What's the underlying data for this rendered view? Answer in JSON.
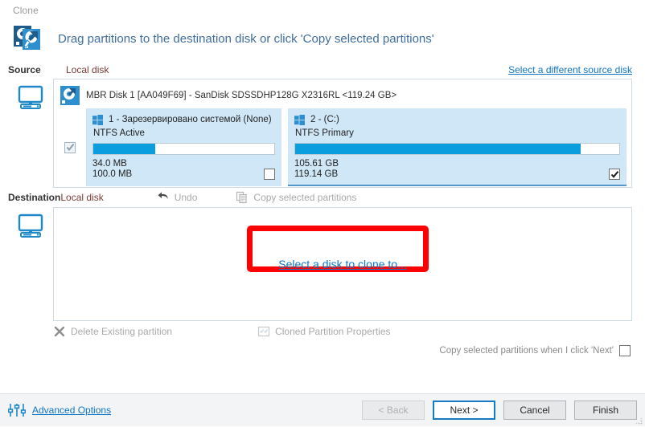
{
  "window": {
    "title": "Clone"
  },
  "header": {
    "title": "Drag partitions to the destination disk or click 'Copy selected partitions'",
    "icon": "clone-disks-icon"
  },
  "source": {
    "label": "Source",
    "disk_type": "Local disk",
    "change_link": "Select a different source disk",
    "monitor_icon": "computer-icon",
    "disk": {
      "icon": "hard-disk-icon",
      "title": "MBR Disk 1 [AA049F69] - SanDisk SDSSDHP128G X2316RL  <119.24 GB>",
      "selected": true,
      "partitions": [
        {
          "index": "1",
          "name": "1 - Зарезервировано системой (None)",
          "filesystem": "NTFS Active",
          "used": "34.0 MB",
          "total": "100.0 MB",
          "used_percent": 34,
          "checked": false,
          "os_icon": "windows-logo-icon"
        },
        {
          "index": "2",
          "name": "2 -  (C:)",
          "filesystem": "NTFS Primary",
          "used": "105.61 GB",
          "total": "119.14 GB",
          "used_percent": 88,
          "checked": true,
          "os_icon": "windows-logo-icon"
        }
      ]
    }
  },
  "destination": {
    "label": "Destination",
    "disk_type": "Local disk",
    "monitor_icon": "computer-icon",
    "toolbar": {
      "undo": "Undo",
      "undo_icon": "undo-arrow-icon",
      "copy_selected": "Copy selected partitions",
      "copy_icon": "copy-pages-icon"
    },
    "empty_link": "Select a disk to clone to...",
    "annotation": "red-highlight-box"
  },
  "bottom_tools": {
    "delete_partition": "Delete Existing partition",
    "delete_icon": "close-x-icon",
    "cloned_properties": "Cloned Partition Properties",
    "properties_icon": "properties-grid-icon"
  },
  "copy_on_next": {
    "label": "Copy selected partitions when I click 'Next'",
    "checked": false
  },
  "footer": {
    "advanced_options": "Advanced Options",
    "advanced_icon": "sliders-icon",
    "buttons": [
      {
        "label": "< Back",
        "state": "disabled"
      },
      {
        "label": "Next >",
        "state": "focused"
      },
      {
        "label": "Cancel",
        "state": "normal"
      },
      {
        "label": "Finish",
        "state": "normal"
      }
    ]
  },
  "colors": {
    "link": "#1076c4",
    "partition_bg": "#cfe7f7",
    "usage_fill": "#0b9ede",
    "annotation": "#ff0000",
    "header_title": "#3f6e9e",
    "local_disk_label": "#7a3b36"
  }
}
